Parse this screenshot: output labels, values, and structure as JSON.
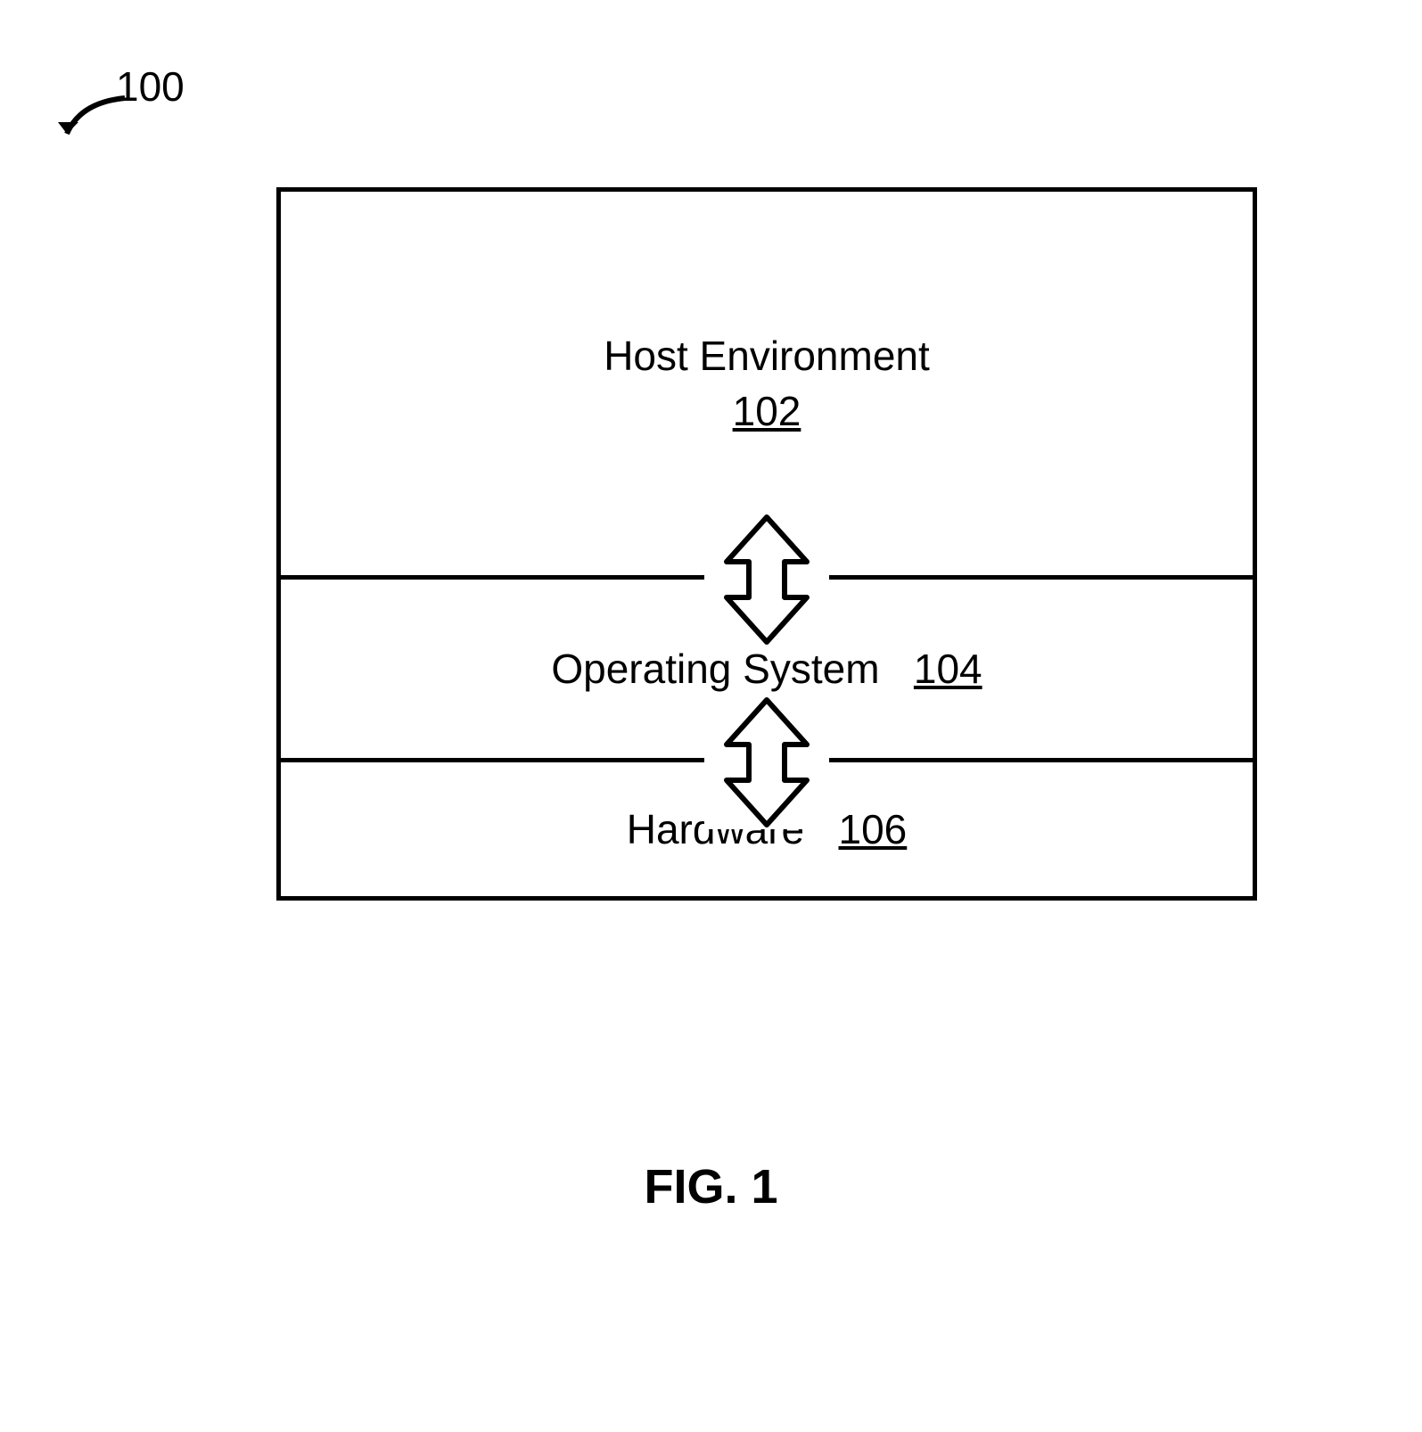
{
  "figure": {
    "reference_number": "100",
    "caption": "FIG. 1",
    "layers": {
      "host_env": {
        "label": "Host Environment",
        "ref": "102"
      },
      "os": {
        "label": "Operating System",
        "ref": "104"
      },
      "hardware": {
        "label": "Hardware",
        "ref": "106"
      }
    }
  }
}
